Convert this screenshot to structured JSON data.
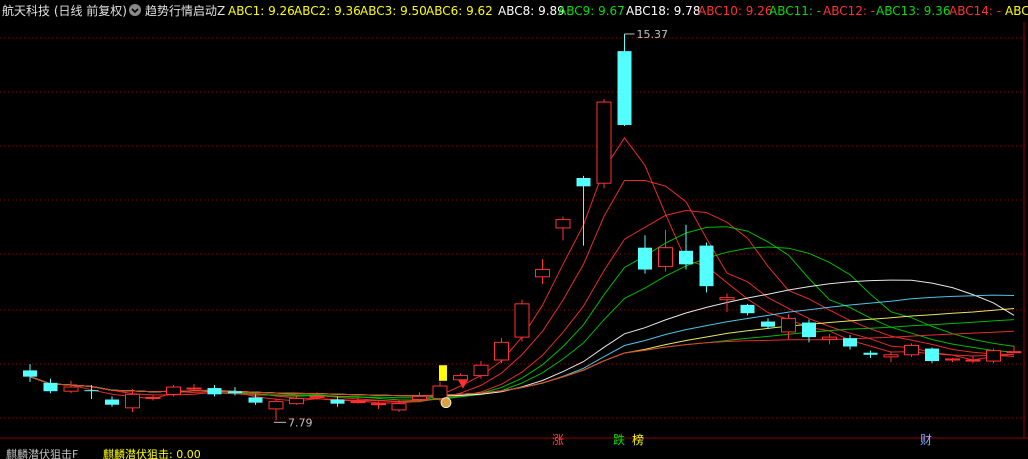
{
  "header": {
    "title": "航天科技 (日线 前复权)",
    "indicator_name": "趋势行情启动Z",
    "values": [
      {
        "label": "ABC1: 9.26",
        "color": "#ffff00"
      },
      {
        "label": "ABC2: 9.36",
        "color": "#ffff00"
      },
      {
        "label": "ABC3: 9.50",
        "color": "#ffff00"
      },
      {
        "label": "ABC6: 9.62",
        "color": "#ffff00"
      },
      {
        "label": "ABC8: 9.89",
        "color": "#ffffff"
      },
      {
        "label": "ABC9: 9.67",
        "color": "#00dd00"
      },
      {
        "label": "ABC18: 9.78",
        "color": "#ffffff"
      },
      {
        "label": "ABC10: 9.26",
        "color": "#ff3030"
      },
      {
        "label": "ABC11: -",
        "color": "#00dd00"
      },
      {
        "label": "ABC12: -",
        "color": "#ff3030"
      },
      {
        "label": "ABC13: 9.36",
        "color": "#00dd00"
      },
      {
        "label": "ABC14: -",
        "color": "#ff3030"
      },
      {
        "label": "ABC",
        "color": "#ffff00"
      }
    ]
  },
  "footer": {
    "left_label": "麒麟潜伏狙击F",
    "right_label": "麒麟潜伏狙击: 0.00"
  },
  "annotations": {
    "high": "15.37",
    "low": "7.79"
  },
  "signals": [
    {
      "text": "涨",
      "color": "#ff4040"
    },
    {
      "text": "跌",
      "color": "#00dd00"
    },
    {
      "text": "榜",
      "color": "#ffff00"
    },
    {
      "text": "财",
      "color": "#88aaff"
    }
  ],
  "colors": {
    "up": "#ff3232",
    "down": "#54ffff",
    "grid": "#8b0000",
    "background": "#000000"
  },
  "chart_data": {
    "type": "candlestick",
    "ylim": [
      7.6,
      15.6
    ],
    "candles": [
      {
        "o": 8.9,
        "c": 8.78,
        "h": 9.02,
        "l": 8.68
      },
      {
        "o": 8.66,
        "c": 8.5,
        "h": 8.74,
        "l": 8.46
      },
      {
        "o": 8.5,
        "c": 8.58,
        "h": 8.7,
        "l": 8.46
      },
      {
        "o": 8.52,
        "c": 8.5,
        "h": 8.62,
        "l": 8.35
      },
      {
        "o": 8.34,
        "c": 8.24,
        "h": 8.4,
        "l": 8.2
      },
      {
        "o": 8.18,
        "c": 8.44,
        "h": 8.54,
        "l": 8.1
      },
      {
        "o": 8.38,
        "c": 8.38,
        "h": 8.42,
        "l": 8.32
      },
      {
        "o": 8.44,
        "c": 8.58,
        "h": 8.62,
        "l": 8.4
      },
      {
        "o": 8.56,
        "c": 8.56,
        "h": 8.64,
        "l": 8.5
      },
      {
        "o": 8.56,
        "c": 8.44,
        "h": 8.62,
        "l": 8.4
      },
      {
        "o": 8.5,
        "c": 8.46,
        "h": 8.58,
        "l": 8.42
      },
      {
        "o": 8.38,
        "c": 8.28,
        "h": 8.44,
        "l": 8.24
      },
      {
        "o": 8.16,
        "c": 8.3,
        "h": 8.36,
        "l": 7.94
      },
      {
        "o": 8.26,
        "c": 8.36,
        "h": 8.42,
        "l": 8.24
      },
      {
        "o": 8.4,
        "c": 8.4,
        "h": 8.48,
        "l": 8.34
      },
      {
        "o": 8.34,
        "c": 8.26,
        "h": 8.4,
        "l": 8.2
      },
      {
        "o": 8.3,
        "c": 8.3,
        "h": 8.38,
        "l": 8.26
      },
      {
        "o": 8.26,
        "c": 8.26,
        "h": 8.3,
        "l": 8.16
      },
      {
        "o": 8.14,
        "c": 8.26,
        "h": 8.34,
        "l": 8.1
      },
      {
        "o": 8.34,
        "c": 8.4,
        "h": 8.48,
        "l": 8.3
      },
      {
        "o": 8.36,
        "c": 8.6,
        "h": 8.68,
        "l": 8.3
      },
      {
        "o": 8.72,
        "c": 8.8,
        "h": 8.84,
        "l": 8.66
      },
      {
        "o": 8.8,
        "c": 9.0,
        "h": 9.08,
        "l": 8.74
      },
      {
        "o": 9.1,
        "c": 9.44,
        "h": 9.52,
        "l": 9.04
      },
      {
        "o": 9.54,
        "c": 10.18,
        "h": 10.26,
        "l": 9.46
      },
      {
        "o": 10.7,
        "c": 10.84,
        "h": 11.04,
        "l": 10.56
      },
      {
        "o": 11.64,
        "c": 11.8,
        "h": 11.86,
        "l": 11.4
      },
      {
        "o": 12.6,
        "c": 12.44,
        "h": 12.64,
        "l": 11.3
      },
      {
        "o": 12.5,
        "c": 14.06,
        "h": 14.12,
        "l": 12.4
      },
      {
        "o": 15.04,
        "c": 13.62,
        "h": 15.37,
        "l": 13.6
      }
    ],
    "candles2": [
      {
        "o": 11.26,
        "c": 10.84,
        "h": 11.5,
        "l": 10.76
      },
      {
        "o": 10.9,
        "c": 11.26,
        "h": 11.6,
        "l": 10.8
      },
      {
        "o": 11.2,
        "c": 10.94,
        "h": 11.7,
        "l": 10.84
      },
      {
        "o": 11.3,
        "c": 10.52,
        "h": 11.36,
        "l": 10.4
      },
      {
        "o": 10.26,
        "c": 10.3,
        "h": 10.38,
        "l": 10.02
      },
      {
        "o": 10.16,
        "c": 10.0,
        "h": 10.18,
        "l": 9.96
      },
      {
        "o": 9.84,
        "c": 9.74,
        "h": 9.9,
        "l": 9.7
      },
      {
        "o": 9.64,
        "c": 9.9,
        "h": 9.98,
        "l": 9.5
      },
      {
        "o": 9.82,
        "c": 9.54,
        "h": 9.88,
        "l": 9.44
      },
      {
        "o": 9.5,
        "c": 9.54,
        "h": 9.6,
        "l": 9.4
      },
      {
        "o": 9.52,
        "c": 9.36,
        "h": 9.58,
        "l": 9.3
      },
      {
        "o": 9.24,
        "c": 9.2,
        "h": 9.28,
        "l": 9.14
      },
      {
        "o": 9.16,
        "c": 9.2,
        "h": 9.26,
        "l": 9.06
      },
      {
        "o": 9.2,
        "c": 9.38,
        "h": 9.42,
        "l": 9.16
      },
      {
        "o": 9.32,
        "c": 9.08,
        "h": 9.34,
        "l": 9.04
      },
      {
        "o": 9.1,
        "c": 9.12,
        "h": 9.14,
        "l": 9.06
      },
      {
        "o": 9.08,
        "c": 9.1,
        "h": 9.18,
        "l": 9.04
      },
      {
        "o": 9.08,
        "c": 9.28,
        "h": 9.32,
        "l": 9.04
      },
      {
        "o": 9.26,
        "c": 9.26,
        "h": 9.38,
        "l": 9.24
      }
    ]
  }
}
